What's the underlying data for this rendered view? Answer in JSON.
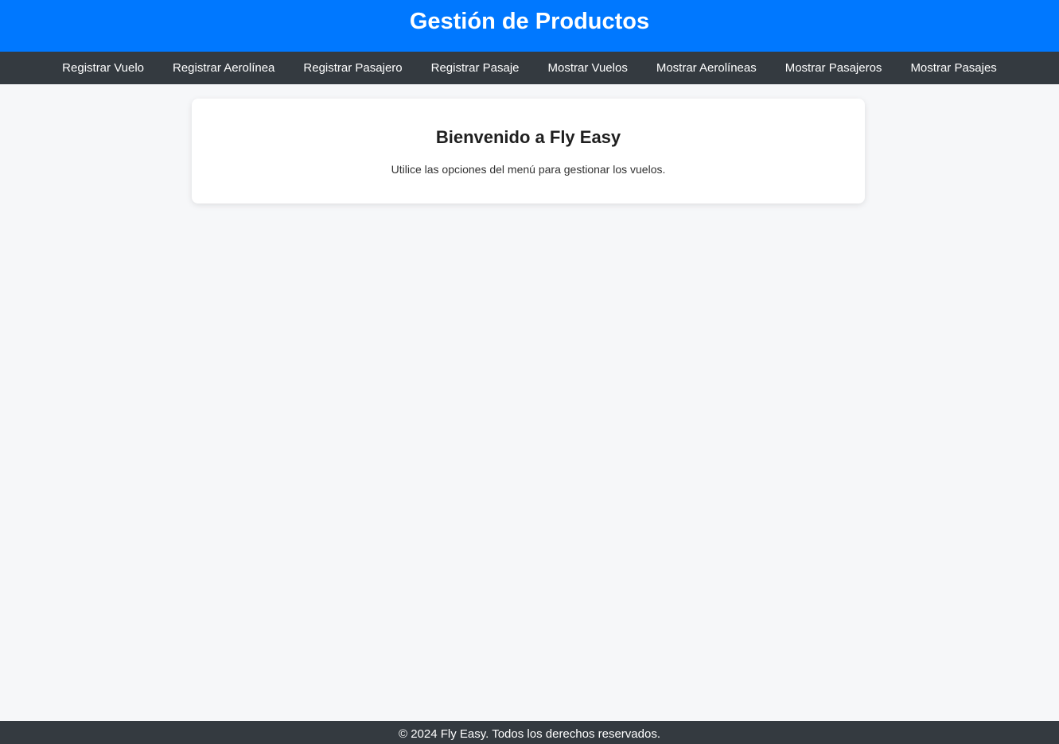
{
  "header": {
    "title": "Gestión de Productos"
  },
  "nav": {
    "items": [
      {
        "label": "Registrar Vuelo"
      },
      {
        "label": "Registrar Aerolínea"
      },
      {
        "label": "Registrar Pasajero"
      },
      {
        "label": "Registrar Pasaje"
      },
      {
        "label": "Mostrar Vuelos"
      },
      {
        "label": "Mostrar Aerolíneas"
      },
      {
        "label": "Mostrar Pasajeros"
      },
      {
        "label": "Mostrar Pasajes"
      }
    ]
  },
  "main": {
    "welcome_title": "Bienvenido a Fly Easy",
    "welcome_text": "Utilice las opciones del menú para gestionar los vuelos."
  },
  "footer": {
    "text": "© 2024 Fly Easy. Todos los derechos reservados."
  },
  "colors": {
    "header_bg": "#0078ff",
    "nav_bg": "#343a40",
    "page_bg": "#f6f7f9",
    "card_bg": "#ffffff"
  }
}
